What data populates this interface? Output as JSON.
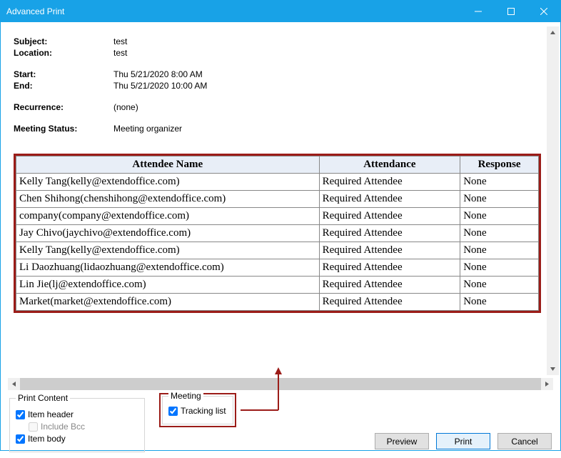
{
  "window": {
    "title": "Advanced Print"
  },
  "info": {
    "subject_label": "Subject:",
    "subject_value": "test",
    "location_label": "Location:",
    "location_value": "test",
    "start_label": "Start:",
    "start_value": "Thu 5/21/2020 8:00 AM",
    "end_label": "End:",
    "end_value": "Thu 5/21/2020 10:00 AM",
    "recurrence_label": "Recurrence:",
    "recurrence_value": "(none)",
    "status_label": "Meeting Status:",
    "status_value": "Meeting organizer"
  },
  "table": {
    "headers": {
      "name": "Attendee Name",
      "attendance": "Attendance",
      "response": "Response"
    },
    "rows": [
      {
        "name": "Kelly Tang(kelly@extendoffice.com)",
        "attendance": "Required Attendee",
        "response": "None"
      },
      {
        "name": "Chen Shihong(chenshihong@extendoffice.com)",
        "attendance": "Required Attendee",
        "response": "None"
      },
      {
        "name": "company(company@extendoffice.com)",
        "attendance": "Required Attendee",
        "response": "None"
      },
      {
        "name": "Jay Chivo(jaychivo@extendoffice.com)",
        "attendance": "Required Attendee",
        "response": "None"
      },
      {
        "name": "Kelly Tang(kelly@extendoffice.com)",
        "attendance": "Required Attendee",
        "response": "None"
      },
      {
        "name": "Li Daozhuang(lidaozhuang@extendoffice.com)",
        "attendance": "Required Attendee",
        "response": "None"
      },
      {
        "name": "Lin Jie(lj@extendoffice.com)",
        "attendance": "Required Attendee",
        "response": "None"
      },
      {
        "name": "Market(market@extendoffice.com)",
        "attendance": "Required Attendee",
        "response": "None"
      }
    ]
  },
  "print_content": {
    "legend": "Print Content",
    "item_header": "Item header",
    "include_bcc": "Include Bcc",
    "item_body": "Item body"
  },
  "meeting_group": {
    "legend": "Meeting",
    "tracking_list": "Tracking list"
  },
  "buttons": {
    "preview": "Preview",
    "print": "Print",
    "cancel": "Cancel"
  }
}
